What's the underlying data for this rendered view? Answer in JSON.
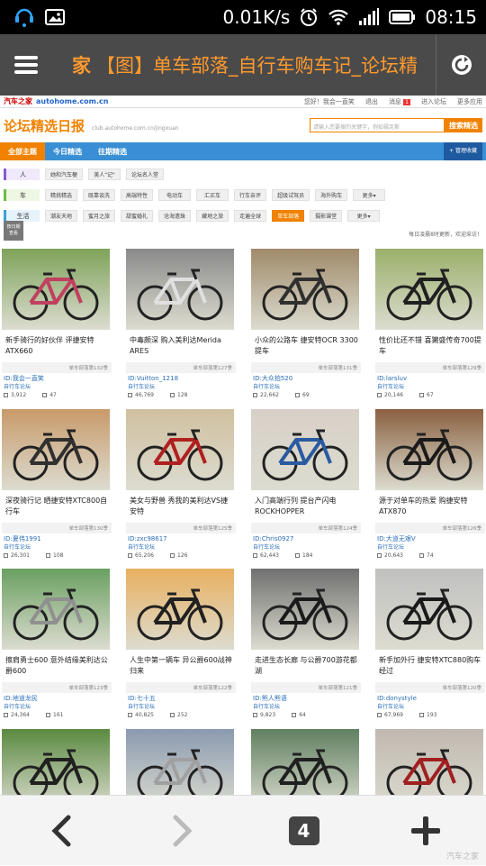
{
  "status_bar": {
    "speed": "0.01K/s",
    "time": "08:15"
  },
  "browser": {
    "title_lead": "家",
    "title": "【图】单车部落_自行车购车记_论坛精"
  },
  "site": {
    "logo_cn": "汽车之家",
    "logo_en": "autohome.com.cn",
    "greeting": "您好！我会一直笑",
    "logout": "退出",
    "messages": "消息",
    "message_count": "1",
    "enter_forum": "进入论坛",
    "more_apps": "更多应用"
  },
  "header": {
    "title": "论坛精选日报",
    "url": "club.autohome.com.cn/jingxuan",
    "search_placeholder": "请输入您要搜的关键字，例如福克斯",
    "search_button": "搜索精选"
  },
  "tabs": [
    "全部主题",
    "今日精选",
    "往期精选"
  ],
  "manage": "管理收藏",
  "categories": [
    {
      "label": "人",
      "chips": [
        "她和汽车梗",
        "美人\"记\"",
        "论坛名人堂"
      ],
      "selected": -1
    },
    {
      "label": "车",
      "chips": [
        "精挑精选",
        "既靠谈洗",
        "高端特性",
        "电动车",
        "汇买车",
        "行车亲评",
        "超级试驾员",
        "海外购车",
        "更多▾"
      ],
      "selected": -1
    },
    {
      "label": "生活",
      "chips": [
        "潮友天地",
        "蜜月之旅",
        "甜蜜婚礼",
        "沧海遗珠",
        "藏地之旅",
        "走遍全球",
        "单车部落",
        "摄影课堂",
        "更多▾"
      ],
      "selected": 6
    }
  ],
  "day_badge": [
    "按日期",
    "查看"
  ],
  "notice": "每日凌晨8时更新，欢迎采访！",
  "posts": [
    {
      "caption": "新手骑行的好伙伴 评捷安特ATX660",
      "category": "单车部落第132季",
      "user": "ID:我会一直笑",
      "forum": "自行车论坛",
      "views": "3,912",
      "replies": "47"
    },
    {
      "caption": "中毒颇深 购入美利达Merida ARES",
      "category": "单车部落第127季",
      "user": "ID:Vuitton_1218",
      "forum": "自行车论坛",
      "views": "46,769",
      "replies": "128"
    },
    {
      "caption": "小众的公路车 捷安特OCR 3300提车",
      "category": "单车部落第131季",
      "user": "ID:大众拍520",
      "forum": "自行车论坛",
      "views": "22,662",
      "replies": "69"
    },
    {
      "caption": "性价比还不错 喜獭盛传奇700提车",
      "category": "单车部落第129季",
      "user": "ID:larsluv",
      "forum": "自行车论坛",
      "views": "20,146",
      "replies": "67"
    },
    {
      "caption": "深夜骑行记 晒捷安特XTC800自行车",
      "category": "单车部落第130季",
      "user": "ID:夏伟1991",
      "forum": "自行车论坛",
      "views": "26,301",
      "replies": "108"
    },
    {
      "caption": "美女与野兽 秀我的美利达VS捷安特",
      "category": "单车部落第125季",
      "user": "ID:zxc98617",
      "forum": "自行车论坛",
      "views": "65,206",
      "replies": "126"
    },
    {
      "caption": "入门高端行列 提台产闪电ROCKHOPPER",
      "category": "单车部落第124季",
      "user": "ID:Chris0927",
      "forum": "自行车论坛",
      "views": "62,443",
      "replies": "184"
    },
    {
      "caption": "源于对单车的热爱 购捷安特ATX870",
      "category": "单车部落第126季",
      "user": "ID:大道无艰V",
      "forum": "自行车论坛",
      "views": "20,643",
      "replies": "74"
    },
    {
      "caption": "擦肩勇士600 意外结缘美利达公爵600",
      "category": "单车部落第123季",
      "user": "ID:地道龙民",
      "forum": "自行车论坛",
      "views": "24,364",
      "replies": "161"
    },
    {
      "caption": "人生中第一辆车 异公爵600战神归来",
      "category": "单车部落第122季",
      "user": "ID:七十五",
      "forum": "自行车论坛",
      "views": "40,825",
      "replies": "252"
    },
    {
      "caption": "走进生态长廊 与公爵700游花都湖",
      "category": "单车部落第121季",
      "user": "ID:熊人熊语",
      "forum": "自行车论坛",
      "views": "9,823",
      "replies": "64"
    },
    {
      "caption": "新手加外行 捷安特XTC880购车经过",
      "category": "单车部落第120季",
      "user": "ID:donystyle",
      "forum": "自行车论坛",
      "views": "67,969",
      "replies": "193"
    },
    {
      "caption": "",
      "category": "",
      "user": "",
      "forum": "",
      "views": "",
      "replies": ""
    },
    {
      "caption": "",
      "category": "",
      "user": "",
      "forum": "",
      "views": "",
      "replies": ""
    },
    {
      "caption": "",
      "category": "",
      "user": "",
      "forum": "",
      "views": "",
      "replies": ""
    },
    {
      "caption": "",
      "category": "",
      "user": "",
      "forum": "",
      "views": "",
      "replies": ""
    }
  ],
  "bottom_bar": {
    "tab_count": "4"
  },
  "watermark": "汽车之家",
  "colors": {
    "accent": "#f08200",
    "tab_blue": "#3a8fd4",
    "link_blue": "#2a6fb8",
    "browser_bar": "#4a4a4a"
  }
}
